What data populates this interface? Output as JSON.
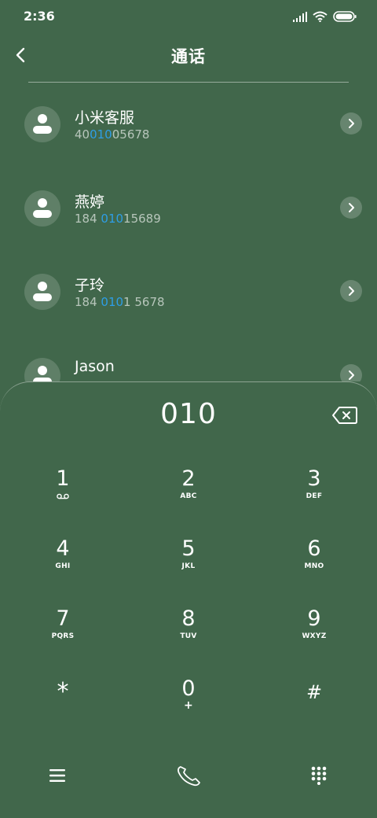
{
  "status_bar": {
    "time": "2:36"
  },
  "header": {
    "title": "通话"
  },
  "contacts": [
    {
      "name": "小米客服",
      "number_pre": "40",
      "number_hl": "010",
      "number_post": "05678"
    },
    {
      "name": "燕婷",
      "number_pre": "184 ",
      "number_hl": "010",
      "number_post": "15689"
    },
    {
      "name": "子玲",
      "number_pre": "184 ",
      "number_hl": "010",
      "number_post": "1 5678"
    },
    {
      "name": "Jason",
      "number_pre": "",
      "number_hl": "",
      "number_post": ""
    }
  ],
  "dialer": {
    "input": "010",
    "keys": [
      {
        "digit": "1",
        "letters": ""
      },
      {
        "digit": "2",
        "letters": "ABC"
      },
      {
        "digit": "3",
        "letters": "DEF"
      },
      {
        "digit": "4",
        "letters": "GHI"
      },
      {
        "digit": "5",
        "letters": "JKL"
      },
      {
        "digit": "6",
        "letters": "MNO"
      },
      {
        "digit": "7",
        "letters": "PQRS"
      },
      {
        "digit": "8",
        "letters": "TUV"
      },
      {
        "digit": "9",
        "letters": "WXYZ"
      },
      {
        "digit": "*",
        "letters": ""
      },
      {
        "digit": "0",
        "letters": "+"
      },
      {
        "digit": "#",
        "letters": ""
      }
    ]
  },
  "colors": {
    "background": "#41674b",
    "highlight": "#2e9ee6"
  },
  "icons": {
    "back": "chevron-left-icon",
    "detail": "chevron-right-icon",
    "backspace": "backspace-icon",
    "menu": "menu-icon",
    "call": "phone-icon",
    "dialpad": "dialpad-icon",
    "voicemail": "voicemail-icon"
  }
}
